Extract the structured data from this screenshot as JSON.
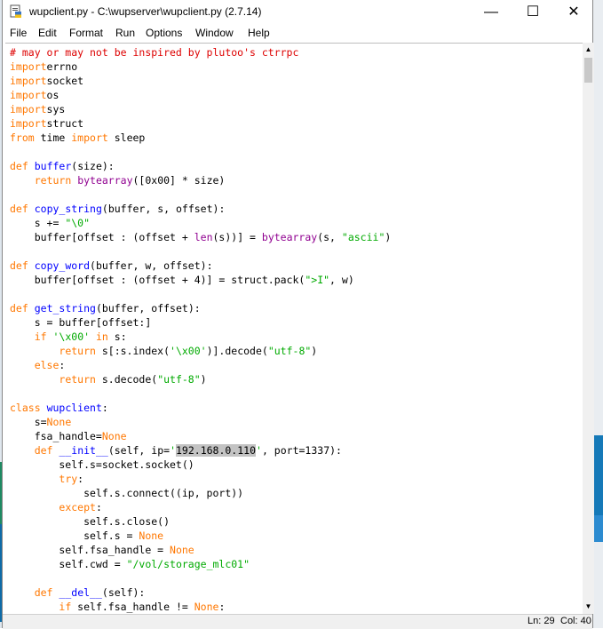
{
  "window": {
    "title": "wupclient.py - C:\\wupserver\\wupclient.py (2.7.14)",
    "minimize_glyph": "—",
    "maximize_glyph": "☐",
    "close_glyph": "✕",
    "icon": "python-file-icon"
  },
  "menu": [
    "File",
    "Edit",
    "Format",
    "Run",
    "Options",
    "Window",
    "Help"
  ],
  "colors": {
    "keyword": "#ff7700",
    "definition": "#0000ff",
    "string": "#00aa00",
    "comment": "#dd0000",
    "builtin": "#900090",
    "selection": "#c3c3c3"
  },
  "code_lines": [
    [
      [
        "cmt",
        "# may or may not be inspired by plutoo's ctrrpc"
      ]
    ],
    [
      [
        "kw",
        "import"
      ],
      [
        "",
        "errno"
      ]
    ],
    [
      [
        "kw",
        "import"
      ],
      [
        "",
        "socket"
      ]
    ],
    [
      [
        "kw",
        "import"
      ],
      [
        "",
        "os"
      ]
    ],
    [
      [
        "kw",
        "import"
      ],
      [
        "",
        "sys"
      ]
    ],
    [
      [
        "kw",
        "import"
      ],
      [
        "",
        "struct"
      ]
    ],
    [
      [
        "kw",
        "from"
      ],
      [
        "",
        " time "
      ],
      [
        "kw",
        "import"
      ],
      [
        "",
        " sleep"
      ]
    ],
    [],
    [
      [
        "kw",
        "def"
      ],
      [
        "",
        " "
      ],
      [
        "def",
        "buffer"
      ],
      [
        "",
        "(size):"
      ]
    ],
    [
      [
        "",
        "    "
      ],
      [
        "kw",
        "return"
      ],
      [
        "",
        " "
      ],
      [
        "bi",
        "bytearray"
      ],
      [
        "",
        "([0x00] * size)"
      ]
    ],
    [],
    [
      [
        "kw",
        "def"
      ],
      [
        "",
        " "
      ],
      [
        "def",
        "copy_string"
      ],
      [
        "",
        "(buffer, s, offset):"
      ]
    ],
    [
      [
        "",
        "    s += "
      ],
      [
        "str",
        "\"\\0\""
      ]
    ],
    [
      [
        "",
        "    buffer[offset : (offset + "
      ],
      [
        "bi",
        "len"
      ],
      [
        "",
        "(s))] = "
      ],
      [
        "bi",
        "bytearray"
      ],
      [
        "",
        "(s, "
      ],
      [
        "str",
        "\"ascii\""
      ],
      [
        "",
        ")"
      ]
    ],
    [],
    [
      [
        "kw",
        "def"
      ],
      [
        "",
        " "
      ],
      [
        "def",
        "copy_word"
      ],
      [
        "",
        "(buffer, w, offset):"
      ]
    ],
    [
      [
        "",
        "    buffer[offset : (offset + 4)] = struct.pack("
      ],
      [
        "str",
        "\">I\""
      ],
      [
        "",
        ", w)"
      ]
    ],
    [],
    [
      [
        "kw",
        "def"
      ],
      [
        "",
        " "
      ],
      [
        "def",
        "get_string"
      ],
      [
        "",
        "(buffer, offset):"
      ]
    ],
    [
      [
        "",
        "    s = buffer[offset:]"
      ]
    ],
    [
      [
        "",
        "    "
      ],
      [
        "kw",
        "if"
      ],
      [
        "",
        " "
      ],
      [
        "str",
        "'\\x00'"
      ],
      [
        "",
        " "
      ],
      [
        "kw",
        "in"
      ],
      [
        "",
        " s:"
      ]
    ],
    [
      [
        "",
        "        "
      ],
      [
        "kw",
        "return"
      ],
      [
        "",
        " s[:s.index("
      ],
      [
        "str",
        "'\\x00'"
      ],
      [
        "",
        ")].decode("
      ],
      [
        "str",
        "\"utf-8\""
      ],
      [
        "",
        ")"
      ]
    ],
    [
      [
        "",
        "    "
      ],
      [
        "kw",
        "else"
      ],
      [
        "",
        ":"
      ]
    ],
    [
      [
        "",
        "        "
      ],
      [
        "kw",
        "return"
      ],
      [
        "",
        " s.decode("
      ],
      [
        "str",
        "\"utf-8\""
      ],
      [
        "",
        ")"
      ]
    ],
    [],
    [
      [
        "kw",
        "class"
      ],
      [
        "",
        " "
      ],
      [
        "def",
        "wupclient"
      ],
      [
        "",
        ":"
      ]
    ],
    [
      [
        "",
        "    s="
      ],
      [
        "kw",
        "None"
      ]
    ],
    [
      [
        "",
        "    fsa_handle="
      ],
      [
        "kw",
        "None"
      ]
    ],
    [
      [
        "",
        "    "
      ],
      [
        "kw",
        "def"
      ],
      [
        "",
        " "
      ],
      [
        "def",
        "__init__"
      ],
      [
        "",
        "(self, ip="
      ],
      [
        "str",
        "'"
      ],
      [
        "sel",
        "192.168.0.110"
      ],
      [
        "str",
        "'"
      ],
      [
        "",
        ", port=1337):"
      ]
    ],
    [
      [
        "",
        "        self.s=socket.socket()"
      ]
    ],
    [
      [
        "",
        "        "
      ],
      [
        "kw",
        "try"
      ],
      [
        "",
        ":"
      ]
    ],
    [
      [
        "",
        "            self.s.connect((ip, port))"
      ]
    ],
    [
      [
        "",
        "        "
      ],
      [
        "kw",
        "except"
      ],
      [
        "",
        ":"
      ]
    ],
    [
      [
        "",
        "            self.s.close()"
      ]
    ],
    [
      [
        "",
        "            self.s = "
      ],
      [
        "kw",
        "None"
      ]
    ],
    [
      [
        "",
        "        self.fsa_handle = "
      ],
      [
        "kw",
        "None"
      ]
    ],
    [
      [
        "",
        "        self.cwd = "
      ],
      [
        "str",
        "\"/vol/storage_mlc01\""
      ]
    ],
    [],
    [
      [
        "",
        "    "
      ],
      [
        "kw",
        "def"
      ],
      [
        "",
        " "
      ],
      [
        "def",
        "__del__"
      ],
      [
        "",
        "(self):"
      ]
    ],
    [
      [
        "",
        "        "
      ],
      [
        "kw",
        "if"
      ],
      [
        "",
        " self.fsa_handle != "
      ],
      [
        "kw",
        "None"
      ],
      [
        "",
        ":"
      ]
    ]
  ],
  "status": {
    "line": "Ln: 29",
    "col": "Col: 40"
  }
}
